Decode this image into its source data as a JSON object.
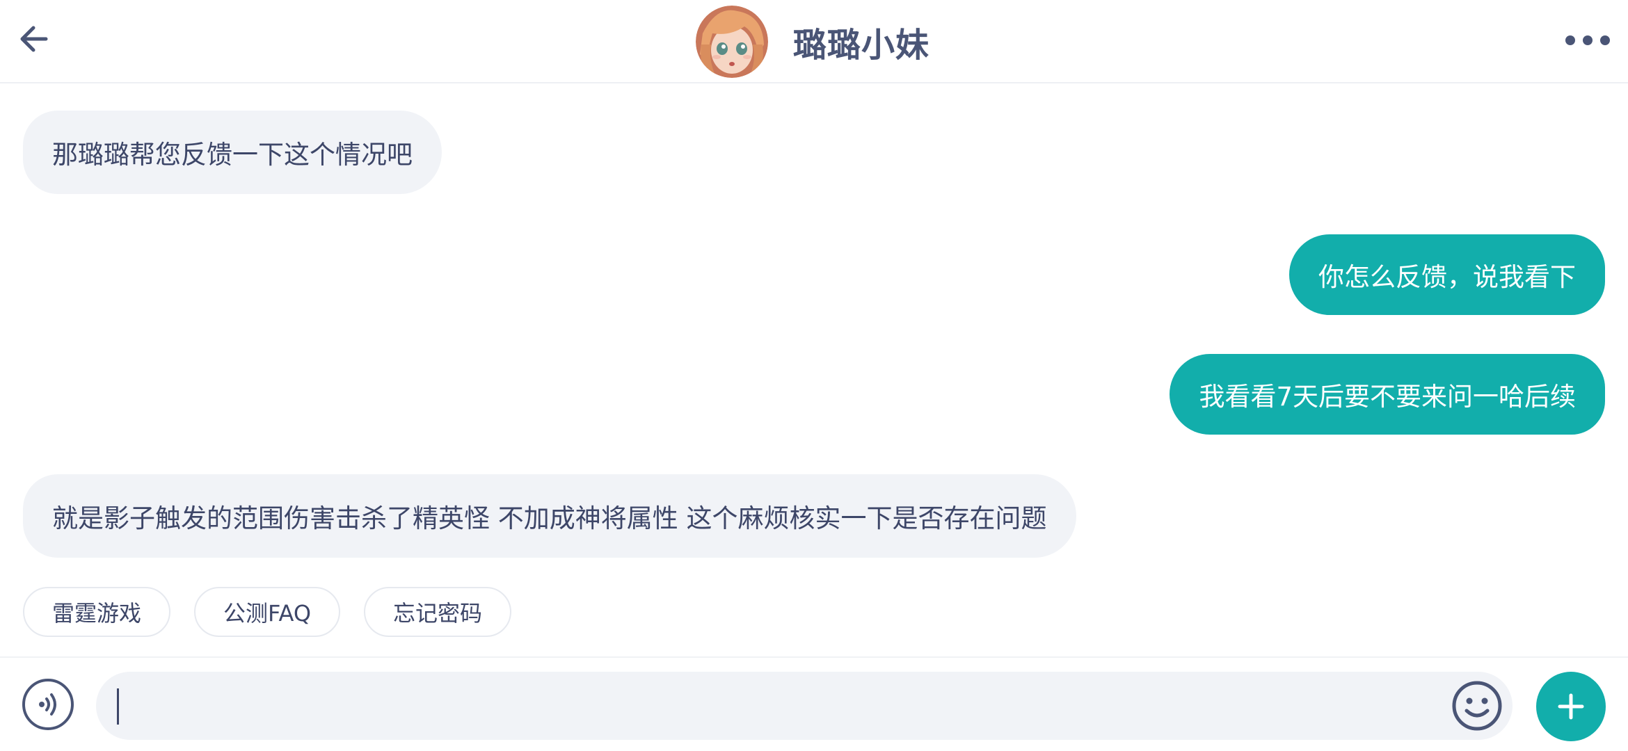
{
  "header": {
    "title": "璐璐小妹",
    "back_icon": "arrow-left-icon",
    "more_icon": "more-horizontal-icon",
    "avatar": "anime-girl-avatar"
  },
  "messages": [
    {
      "side": "in",
      "text": "那璐璐帮您反馈一下这个情况吧"
    },
    {
      "side": "out",
      "text": "你怎么反馈，说我看下"
    },
    {
      "side": "out",
      "text": "我看看7天后要不要来问一哈后续"
    },
    {
      "side": "in",
      "text": "就是影子触发的范围伤害击杀了精英怪 不加成神将属性 这个麻烦核实一下是否存在问题"
    }
  ],
  "quick_replies": [
    "雷霆游戏",
    "公测FAQ",
    "忘记密码"
  ],
  "input": {
    "value": "",
    "voice_icon": "voice-icon",
    "emoji_icon": "emoji-icon",
    "plus_icon": "plus-icon"
  },
  "colors": {
    "accent": "#12aeab",
    "incoming_bubble": "#f1f3f7",
    "text_dark": "#3d4668"
  }
}
